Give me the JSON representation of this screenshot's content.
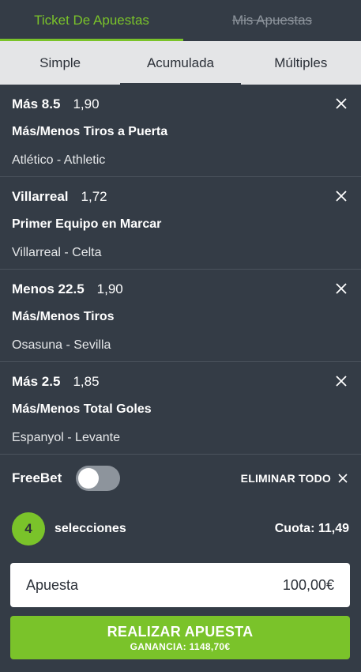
{
  "top_tabs": [
    {
      "label": "Ticket De Apuestas",
      "active": true
    },
    {
      "label": "Mis Apuestas",
      "active": false
    }
  ],
  "sub_tabs": [
    {
      "label": "Simple"
    },
    {
      "label": "Acumulada"
    },
    {
      "label": "Múltiples"
    }
  ],
  "bets": [
    {
      "pick": "Más 8.5",
      "odds": "1,90",
      "market": "Más/Menos Tiros a Puerta",
      "match": "Atlético - Athletic",
      "close_icon": "close-icon"
    },
    {
      "pick": "Villarreal",
      "odds": "1,72",
      "market": "Primer Equipo en Marcar",
      "match": "Villarreal - Celta",
      "close_icon": "close-icon"
    },
    {
      "pick": "Menos 22.5",
      "odds": "1,90",
      "market": "Más/Menos Tiros",
      "match": "Osasuna - Sevilla",
      "close_icon": "close-icon"
    },
    {
      "pick": "Más 2.5",
      "odds": "1,85",
      "market": "Más/Menos Total Goles",
      "match": "Espanyol - Levante",
      "close_icon": "close-icon"
    }
  ],
  "freebet": {
    "label": "FreeBet",
    "enabled": false
  },
  "clear_all": {
    "label": "ELIMINAR TODO"
  },
  "selections": {
    "count": "4",
    "label": "selecciones",
    "total_odds": "Cuota: 11,49"
  },
  "stake": {
    "label": "Apuesta",
    "value": "100,00€"
  },
  "place_bet": {
    "label": "REALIZAR APUESTA",
    "winnings": "GANANCIA: 1148,70€"
  },
  "colors": {
    "background": "#343c46",
    "accent": "#7ac32a",
    "subtabs_bg": "#e4e5e7",
    "toggle_off": "#8d949c"
  }
}
